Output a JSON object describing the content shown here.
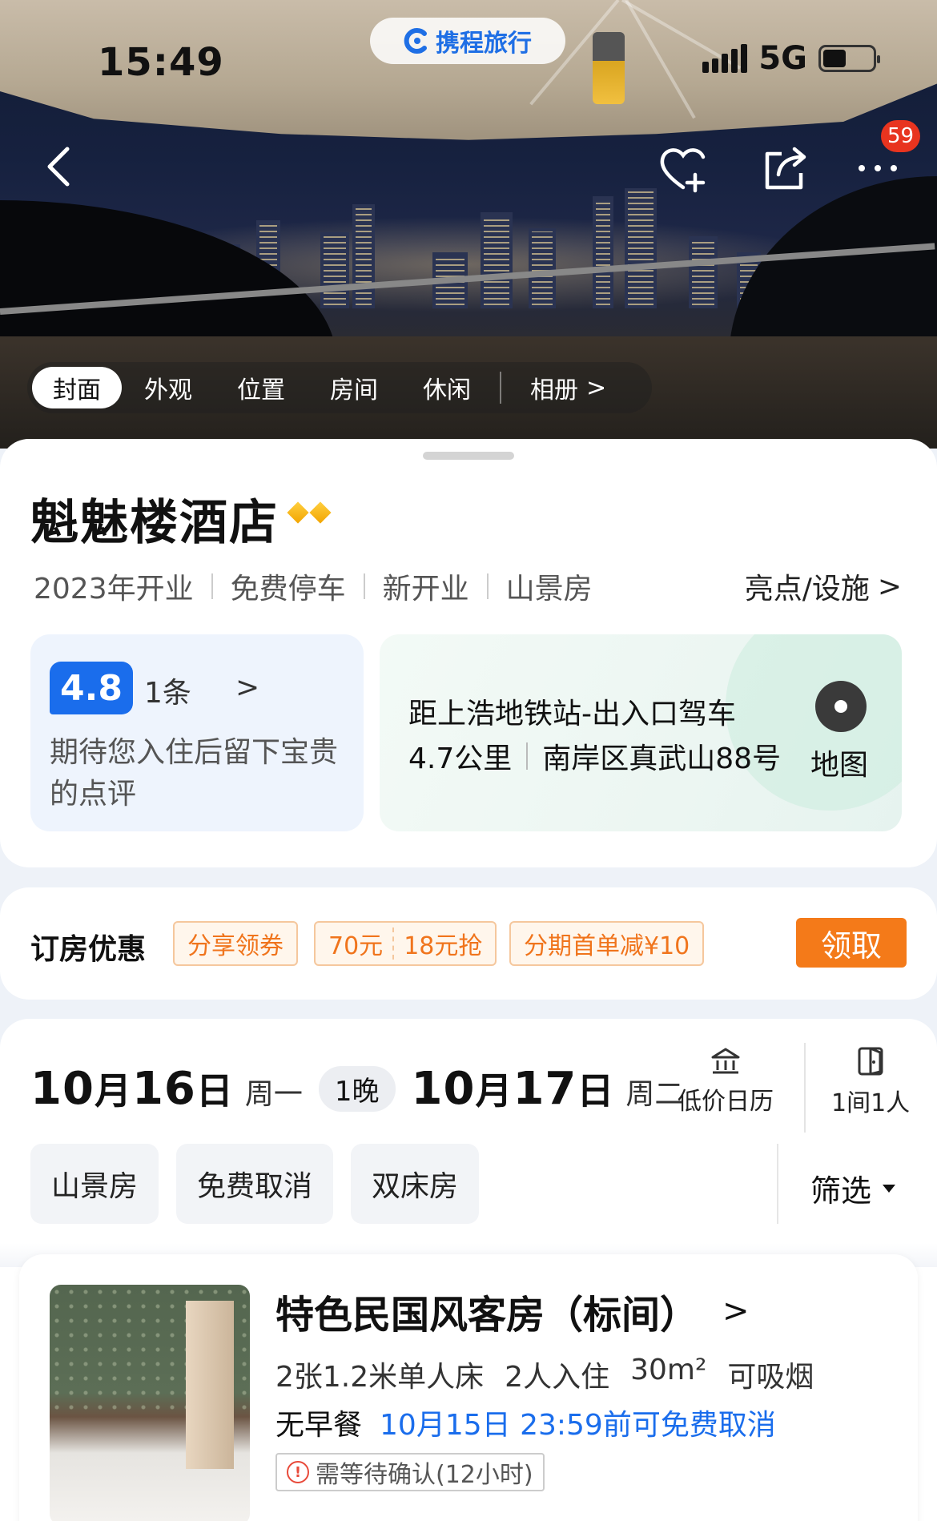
{
  "status_bar": {
    "time": "15:49",
    "brand": "携程旅行",
    "network": "5G"
  },
  "top_actions": {
    "badge_count": "59"
  },
  "photo_tabs": [
    "封面",
    "外观",
    "位置",
    "房间",
    "休闲",
    "相册"
  ],
  "photo_tabs_more": ">",
  "hotel": {
    "name": "魁魅楼酒店",
    "tags": [
      "2023年开业",
      "免费停车",
      "新开业",
      "山景房"
    ],
    "highlights_label": "亮点/设施",
    "chevron": ">"
  },
  "review": {
    "score": "4.8",
    "count": "1条",
    "chevron": ">",
    "text": "期待您入住后留下宝贵的点评"
  },
  "location": {
    "line1": "距上浩地铁站-出入口驾车",
    "distance": "4.7公里",
    "address": "南岸区真武山88号",
    "map_label": "地图"
  },
  "offers": {
    "title": "订房优惠",
    "coupon1": "分享领券",
    "coupon2a": "70元",
    "coupon2b": "18元抢",
    "coupon3": "分期首单减¥10",
    "claim_label": "领取"
  },
  "booking": {
    "checkin_month": "10",
    "checkin_day": "16",
    "checkin_weekday": "周一",
    "nights": "1晚",
    "checkout_month": "10",
    "checkout_day": "17",
    "checkout_weekday": "周二",
    "month_unit": "月",
    "day_unit": "日",
    "calendar_label": "低价日历",
    "guests_label": "1间1人",
    "filter_chips": [
      "山景房",
      "免费取消",
      "双床房"
    ],
    "filter_label": "筛选"
  },
  "room": {
    "title": "特色民国风客房（标间）",
    "chevron": ">",
    "beds": "2张1.2米单人床",
    "occupancy": "2人入住",
    "area": "30m²",
    "smoking": "可吸烟",
    "breakfast": "无早餐",
    "cancel_policy": "10月15日 23:59前可免费取消",
    "confirm_note": "需等待确认(12小时)"
  },
  "colors": {
    "brand_blue": "#1a6dec",
    "offer_orange": "#f47a19",
    "badge_red": "#e8341f"
  }
}
